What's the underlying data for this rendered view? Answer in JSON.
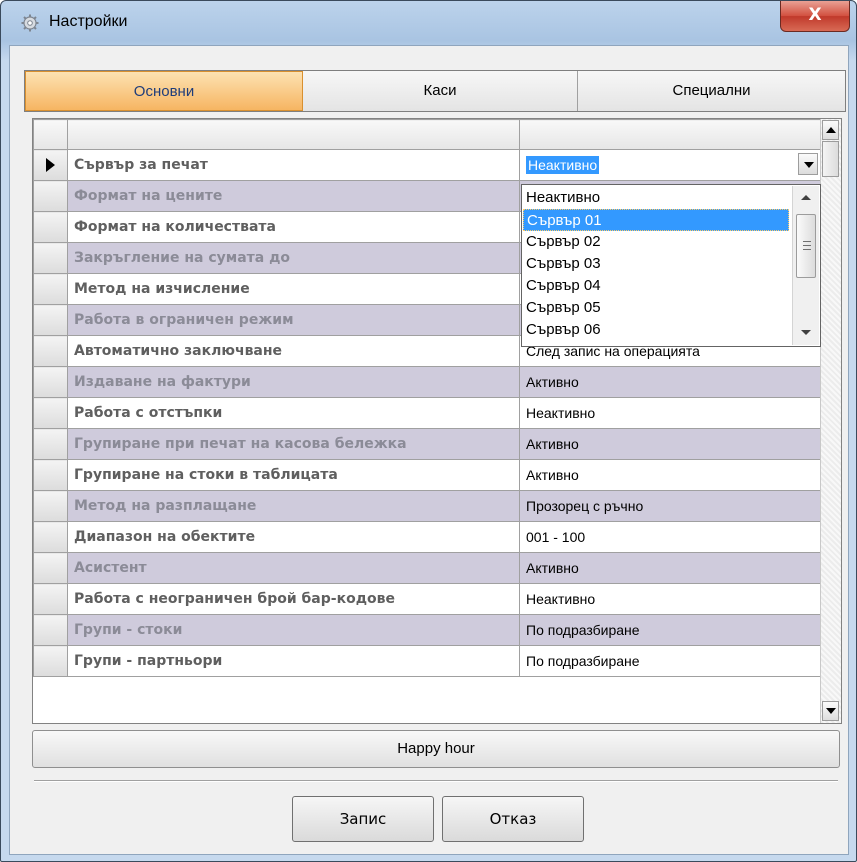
{
  "window": {
    "title": "Настройки",
    "close_label": "X"
  },
  "tabs": [
    {
      "label": "Основни",
      "active": true
    },
    {
      "label": "Каси",
      "active": false
    },
    {
      "label": "Специални",
      "active": false
    }
  ],
  "grid": {
    "rows": [
      {
        "name": "Сървър за печат",
        "value": "Неактивно"
      },
      {
        "name": "Формат на цените",
        "value": ""
      },
      {
        "name": "Формат на количествата",
        "value": ""
      },
      {
        "name": "Закръгление на сумата до",
        "value": ""
      },
      {
        "name": "Метод на изчисление",
        "value": ""
      },
      {
        "name": "Работа в ограничен режим",
        "value": ""
      },
      {
        "name": "Автоматично заключване",
        "value": "След запис на операцията"
      },
      {
        "name": "Издаване на фактури",
        "value": "Активно"
      },
      {
        "name": "Работа с отстъпки",
        "value": "Неактивно"
      },
      {
        "name": "Групиране при печат на касова бележка",
        "value": "Активно"
      },
      {
        "name": "Групиране на стоки в таблицата",
        "value": "Активно"
      },
      {
        "name": "Метод на разплащане",
        "value": "Прозорец с ръчно"
      },
      {
        "name": "Диапазон на обектите",
        "value": "001 - 100"
      },
      {
        "name": "Асистент",
        "value": "Активно"
      },
      {
        "name": "Работа с неограничен брой бар-кодове",
        "value": "Неактивно"
      },
      {
        "name": "Групи - стоки",
        "value": "По подразбиране"
      },
      {
        "name": "Групи - партньори",
        "value": "По подразбиране"
      }
    ]
  },
  "dropdown": {
    "options": [
      "Неактивно",
      "Сървър 01",
      "Сървър 02",
      "Сървър 03",
      "Сървър 04",
      "Сървър 05",
      "Сървър 06"
    ],
    "highlighted": "Сървър 01"
  },
  "buttons": {
    "happy_hour": "Happy hour",
    "save": "Запис",
    "cancel": "Отказ"
  },
  "colors": {
    "active_tab": "#f6b562",
    "alt_row": "#cfcbdc",
    "selection": "#3399ff"
  }
}
